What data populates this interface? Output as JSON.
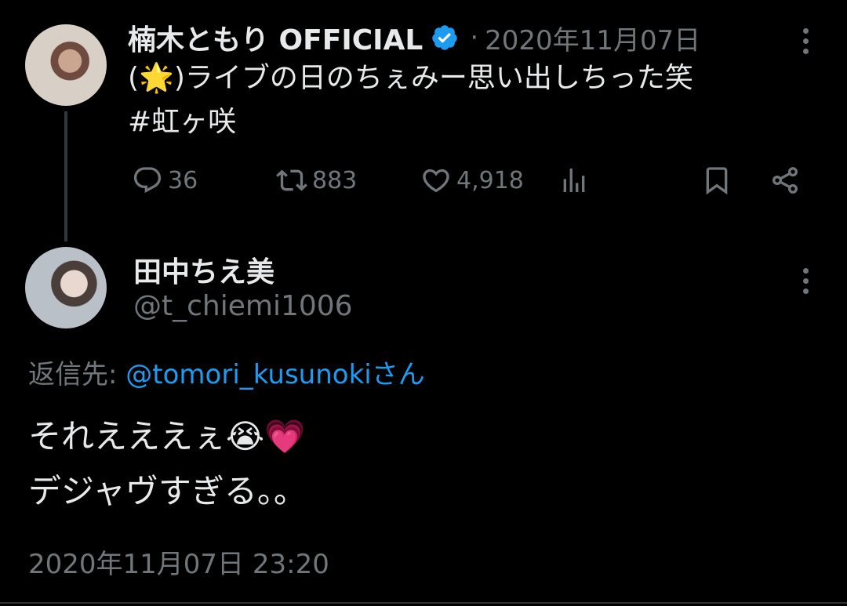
{
  "tweet1": {
    "name": "楠木ともり OFFICIAL",
    "separator": "·",
    "date": "2020年11月07日",
    "text_prefix": "(",
    "text_emoji": "🌟",
    "text_rest": ")ライブの日のちぇみー思い出しちった笑",
    "hashtag": "#虹ヶ咲",
    "stats": {
      "replies": "36",
      "retweets": "883",
      "likes": "4,918"
    }
  },
  "tweet2": {
    "name": "田中ちえ美",
    "handle": "@t_chiemi1006",
    "reply_label": "返信先:",
    "reply_to": "@tomori_kusunoki",
    "reply_suffix": "さん",
    "line1": "それえええぇ",
    "line1_emoji": "😭💗",
    "line2": "デジャヴすぎる。。",
    "timestamp": "2020年11月07日 23:20"
  },
  "colors": {
    "background": "#000000",
    "text": "#e7e9ea",
    "muted": "#71767b",
    "accent": "#1d9bf0"
  },
  "icons": {
    "verified": "verified-badge-icon",
    "reply": "reply-icon",
    "retweet": "retweet-icon",
    "like": "heart-icon",
    "views": "views-icon",
    "bookmark": "bookmark-icon",
    "share": "share-icon",
    "more": "more-icon"
  }
}
